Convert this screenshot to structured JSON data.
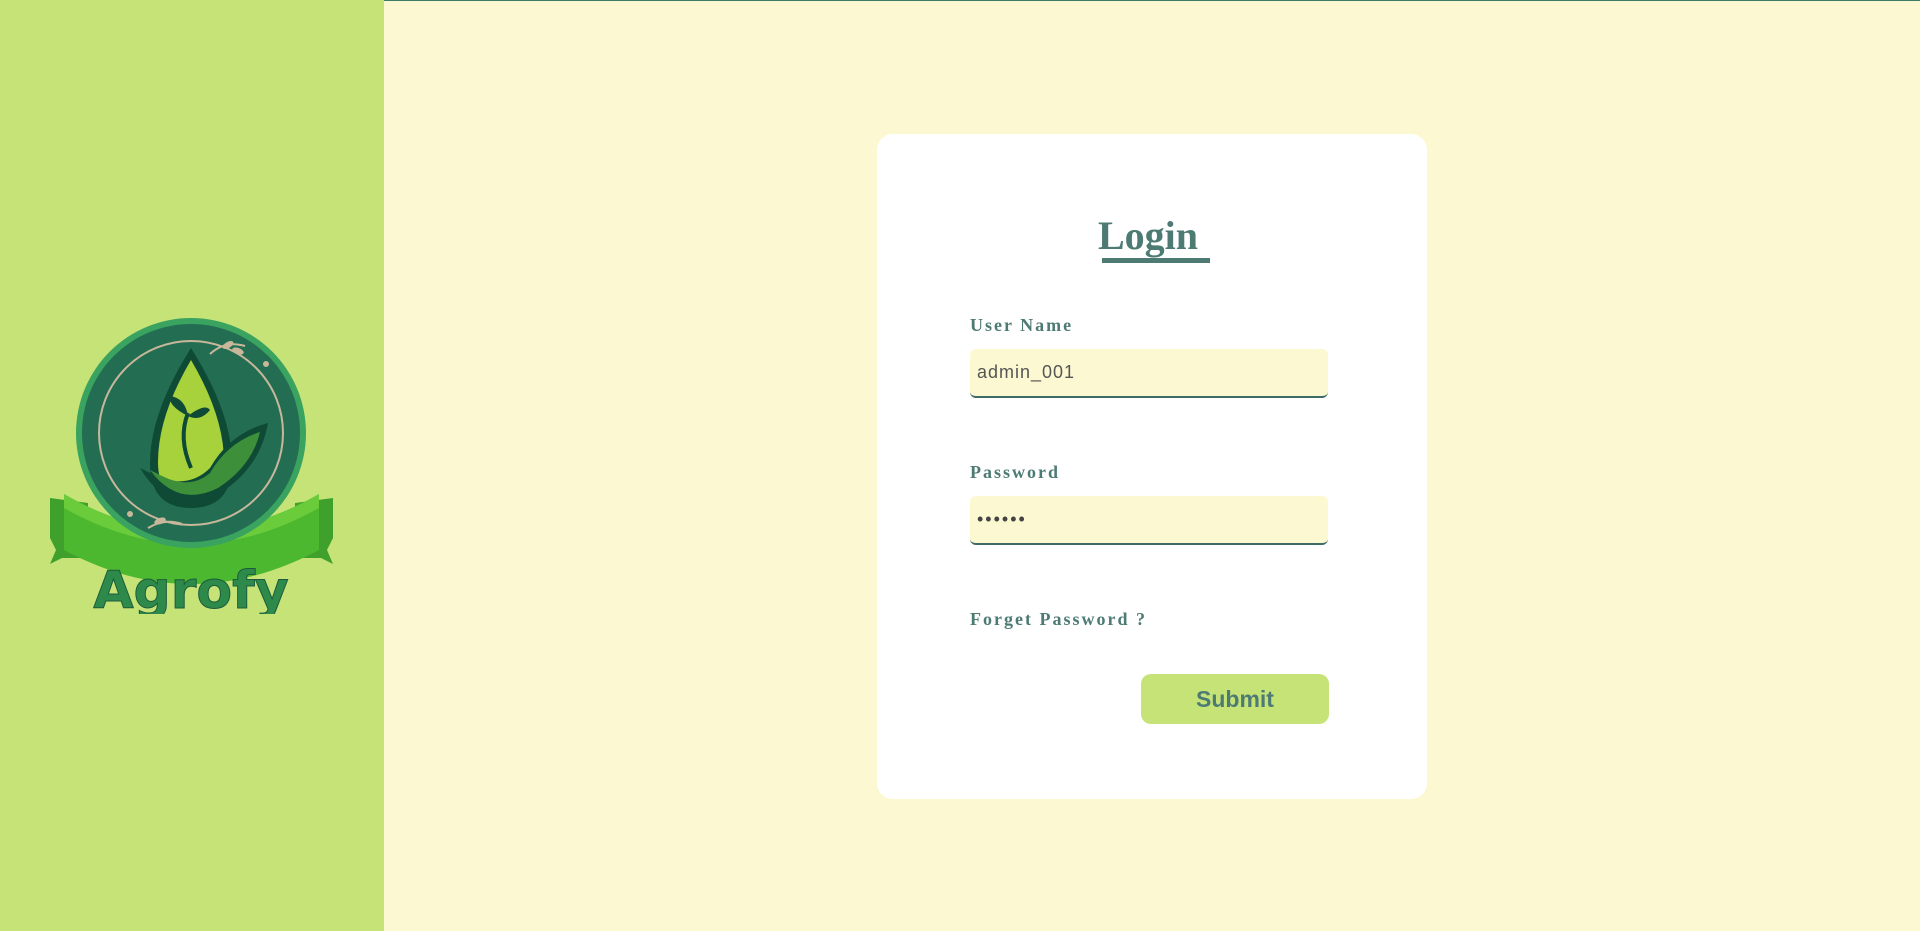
{
  "brand": {
    "logo_text": "Agrofy",
    "colors": {
      "sidebar_bg": "#c6e378",
      "page_bg": "#fcf9d2",
      "accent": "#4d7b73",
      "card_bg": "#ffffff"
    }
  },
  "login": {
    "title": "Login",
    "username": {
      "label": "User Name",
      "value": "admin_001"
    },
    "password": {
      "label": "Password",
      "value": "••••••"
    },
    "forgot_label": "Forget Password ?",
    "submit_label": "Submit"
  }
}
